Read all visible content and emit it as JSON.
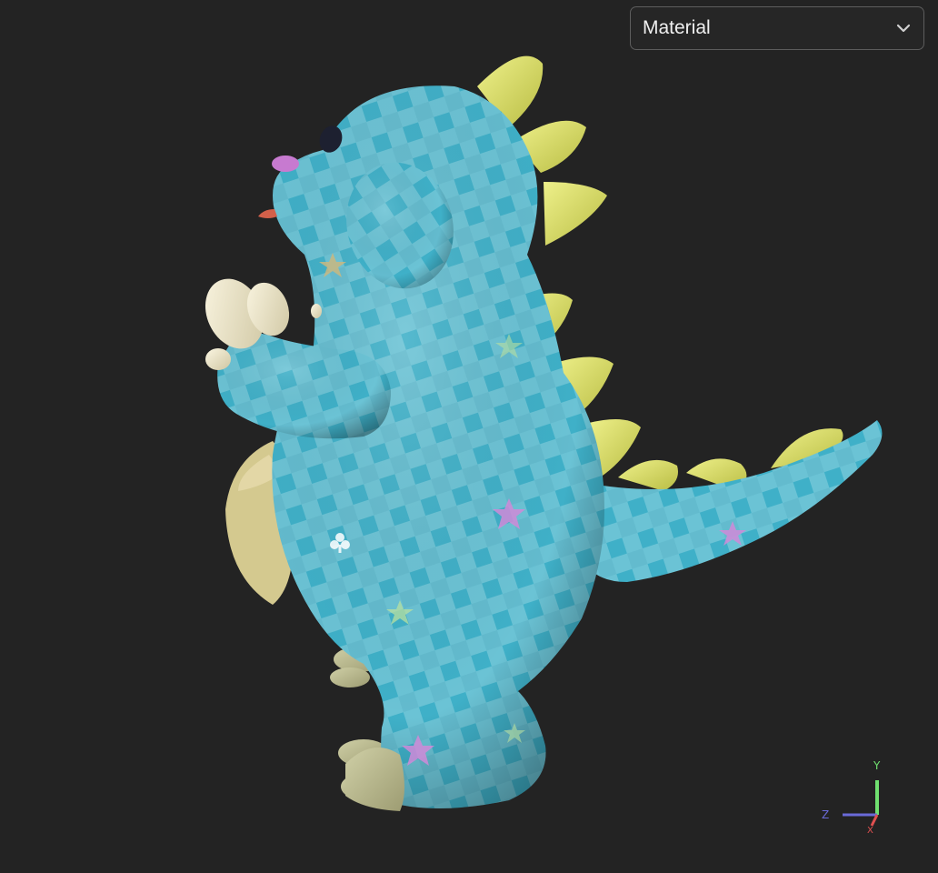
{
  "viewer": {
    "background": "#232323",
    "model_name": "",
    "shading_mode": {
      "selected": "Material",
      "icon": "chevron-down-icon"
    }
  },
  "axis_gizmo": {
    "x_label": "X",
    "y_label": "Y",
    "z_label": "Z",
    "x_color": "#e05050",
    "y_color": "#70e070",
    "z_color": "#6a6ad8"
  },
  "colors": {
    "body": "#3aa9c2",
    "body_light": "#7fd0df",
    "spikes": "#d6dc6a",
    "claws": "#ece3c2",
    "belly_pouch": "#d7cd98",
    "feet": "#b9b88e"
  }
}
